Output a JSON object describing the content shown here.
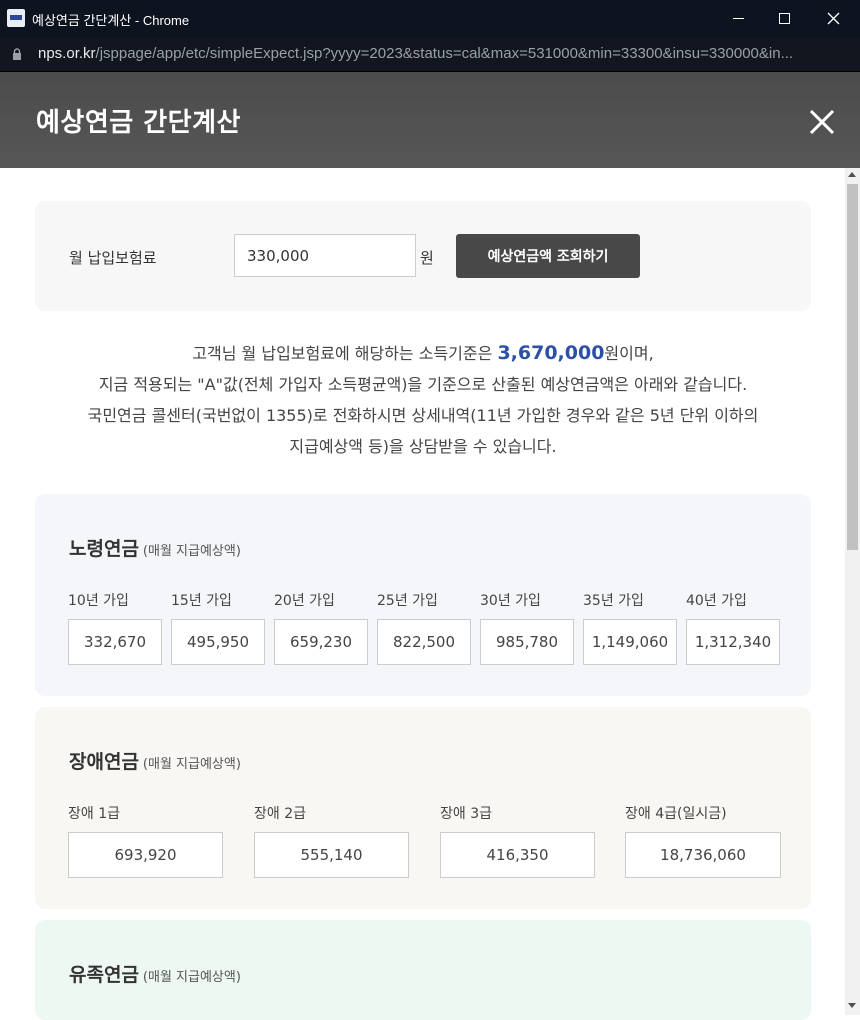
{
  "window": {
    "title": "예상연금 간단계산 - Chrome"
  },
  "address": {
    "host": "nps.or.kr",
    "path": "/jsppage/app/etc/simpleExpect.jsp?yyyy=2023&status=cal&max=531000&min=33300&insu=330000&in..."
  },
  "modal": {
    "title": "예상연금 간단계산"
  },
  "input": {
    "label": "월 납입보험료",
    "value": "330,000",
    "unit": "원",
    "button": "예상연금액 조회하기"
  },
  "description": {
    "line1_pre": "고객님 월 납입보험료에 해당하는 소득기준은 ",
    "line1_amount": "3,670,000",
    "line1_post": "원이며,",
    "line2": "지금 적용되는 \"A\"값(전체 가입자 소득평균액)을 기준으로 산출된 예상연금액은 아래와 같습니다.",
    "line3": "국민연금 콜센터(국번없이 1355)로 전화하시면 상세내역(11년 가입한 경우와 같은 5년 단위 이하의",
    "line4": "지급예상액 등)을 상담받을 수 있습니다."
  },
  "old_age": {
    "title": "노령연금",
    "subtitle": "(매월 지급예상액)",
    "items": [
      {
        "label": "10년 가입",
        "value": "332,670"
      },
      {
        "label": "15년 가입",
        "value": "495,950"
      },
      {
        "label": "20년 가입",
        "value": "659,230"
      },
      {
        "label": "25년 가입",
        "value": "822,500"
      },
      {
        "label": "30년 가입",
        "value": "985,780"
      },
      {
        "label": "35년 가입",
        "value": "1,149,060"
      },
      {
        "label": "40년 가입",
        "value": "1,312,340"
      }
    ]
  },
  "disability": {
    "title": "장애연금",
    "subtitle": "(매월 지급예상액)",
    "items": [
      {
        "label": "장애 1급",
        "value": "693,920"
      },
      {
        "label": "장애 2급",
        "value": "555,140"
      },
      {
        "label": "장애 3급",
        "value": "416,350"
      },
      {
        "label": "장애 4급(일시금)",
        "value": "18,736,060"
      }
    ]
  },
  "survivor": {
    "title": "유족연금",
    "subtitle": "(매월 지급예상액)"
  },
  "colors": {
    "accent": "#2c50a8",
    "header_bg": "#505050",
    "button_bg": "#484848"
  },
  "icons": {
    "close": "close-icon",
    "lock": "lock-icon"
  }
}
